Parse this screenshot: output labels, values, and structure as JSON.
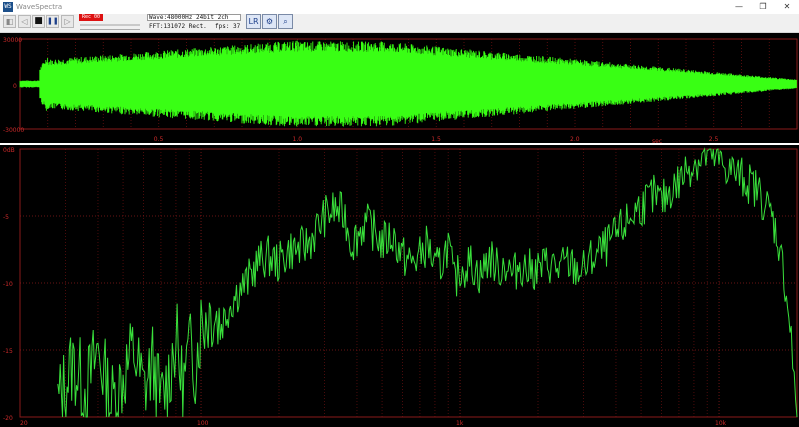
{
  "window": {
    "title": "WaveSpectra",
    "app_icon": "WS",
    "minimize": "—",
    "restore": "❐",
    "close": "✕"
  },
  "toolbar": {
    "marker_label": "Rec 00",
    "wave_info": "Wave:48000Hz 24bit 2ch",
    "fft_label": "FFT:131072 Rect.",
    "fps_label": "fps: 37"
  },
  "waveform": {
    "y_labels": [
      "30000",
      "0",
      "-30000"
    ],
    "x_labels": [
      {
        "t": 0.5,
        "label": "0.5"
      },
      {
        "t": 1.0,
        "label": "1.0"
      },
      {
        "t": 1.5,
        "label": "1.5"
      },
      {
        "t": 2.0,
        "label": "2.0"
      },
      {
        "t": 2.5,
        "label": "2.5"
      }
    ],
    "unit_label": "sec",
    "duration_sec": 2.8,
    "color": "#39ff14"
  },
  "chart_data": {
    "type": "line",
    "x_scale": "log",
    "xlim": [
      20,
      20000
    ],
    "ylim": [
      -20,
      0
    ],
    "x_tick_labels": [
      "20",
      "100",
      "1k",
      "10k"
    ],
    "y_tick_labels": [
      "0dB",
      "-5",
      "-10",
      "-15",
      "-20"
    ],
    "series": [
      {
        "color": "#39e03b",
        "points": [
          [
            28,
            -19
          ],
          [
            32,
            -16
          ],
          [
            36,
            -18
          ],
          [
            40,
            -15
          ],
          [
            45,
            -19
          ],
          [
            50,
            -17
          ],
          [
            55,
            -15
          ],
          [
            60,
            -18
          ],
          [
            65,
            -16
          ],
          [
            70,
            -19
          ],
          [
            75,
            -17
          ],
          [
            80,
            -14
          ],
          [
            85,
            -18
          ],
          [
            90,
            -15
          ],
          [
            95,
            -16
          ],
          [
            100,
            -13
          ],
          [
            110,
            -12
          ],
          [
            120,
            -13
          ],
          [
            130,
            -11.5
          ],
          [
            140,
            -10.5
          ],
          [
            150,
            -10
          ],
          [
            165,
            -8.5
          ],
          [
            180,
            -8
          ],
          [
            200,
            -8.5
          ],
          [
            220,
            -7.5
          ],
          [
            240,
            -7.5
          ],
          [
            260,
            -7
          ],
          [
            280,
            -6
          ],
          [
            300,
            -5
          ],
          [
            330,
            -4.5
          ],
          [
            360,
            -5
          ],
          [
            380,
            -7
          ],
          [
            400,
            -6.5
          ],
          [
            430,
            -5.5
          ],
          [
            460,
            -6
          ],
          [
            500,
            -7
          ],
          [
            550,
            -6.5
          ],
          [
            600,
            -8
          ],
          [
            650,
            -8.5
          ],
          [
            700,
            -8
          ],
          [
            750,
            -7
          ],
          [
            800,
            -9
          ],
          [
            850,
            -8.5
          ],
          [
            900,
            -7
          ],
          [
            950,
            -10
          ],
          [
            1000,
            -9
          ],
          [
            1100,
            -8.5
          ],
          [
            1200,
            -9.5
          ],
          [
            1300,
            -8
          ],
          [
            1400,
            -9
          ],
          [
            1500,
            -8.5
          ],
          [
            1600,
            -9.5
          ],
          [
            1700,
            -8.5
          ],
          [
            1800,
            -9
          ],
          [
            2000,
            -9
          ],
          [
            2200,
            -8.5
          ],
          [
            2400,
            -9
          ],
          [
            2600,
            -8.5
          ],
          [
            2800,
            -9
          ],
          [
            3000,
            -9
          ],
          [
            3300,
            -8
          ],
          [
            3600,
            -7.5
          ],
          [
            4000,
            -6.5
          ],
          [
            4400,
            -5.5
          ],
          [
            4800,
            -4.5
          ],
          [
            5200,
            -4
          ],
          [
            5600,
            -3.5
          ],
          [
            6000,
            -4
          ],
          [
            6500,
            -3
          ],
          [
            7000,
            -2.5
          ],
          [
            7500,
            -1.5
          ],
          [
            8000,
            -1
          ],
          [
            8500,
            -0.8
          ],
          [
            9000,
            -0.5
          ],
          [
            9500,
            -0.6
          ],
          [
            10000,
            -1
          ],
          [
            11000,
            -1.5
          ],
          [
            12000,
            -2
          ],
          [
            13000,
            -2.5
          ],
          [
            14000,
            -3
          ],
          [
            15000,
            -4
          ],
          [
            16000,
            -5
          ],
          [
            17000,
            -7
          ],
          [
            18000,
            -10
          ],
          [
            19000,
            -14
          ],
          [
            19500,
            -18
          ],
          [
            20000,
            -20
          ]
        ]
      }
    ]
  }
}
